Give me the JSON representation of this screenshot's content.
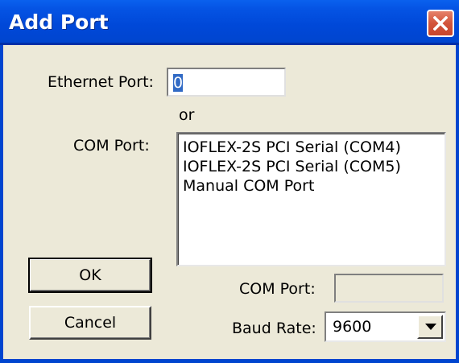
{
  "window": {
    "title": "Add Port"
  },
  "ethernet": {
    "label": "Ethernet Port:",
    "value": "0"
  },
  "or_text": "or",
  "com_list": {
    "label": "COM Port:",
    "items": [
      "IOFLEX-2S PCI Serial (COM4)",
      "IOFLEX-2S PCI Serial (COM5)",
      "Manual COM Port"
    ]
  },
  "manual_com": {
    "label": "COM Port:",
    "value": ""
  },
  "baud": {
    "label": "Baud Rate:",
    "value": "9600"
  },
  "buttons": {
    "ok": "OK",
    "cancel": "Cancel"
  },
  "icons": {
    "close": "close-icon",
    "dropdown": "chevron-down-icon"
  },
  "colors": {
    "titlebar": "#0048d8",
    "dialog_bg": "#ece9d8",
    "close": "#d2533a",
    "selection": "#316ac5"
  }
}
